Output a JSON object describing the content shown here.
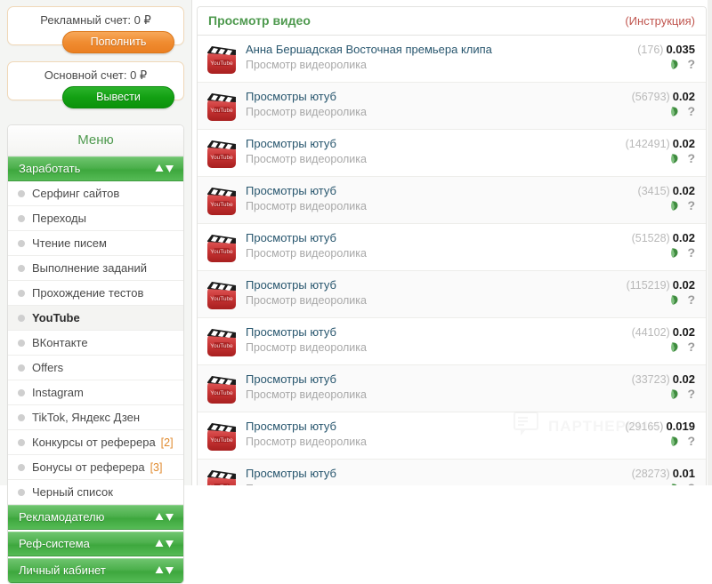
{
  "sidebar": {
    "accounts": [
      {
        "label": "Рекламный счет: 0 ₽",
        "button": "Пополнить",
        "style": "orange",
        "name": "ad-account"
      },
      {
        "label": "Основной счет: 0 ₽",
        "button": "Вывести",
        "style": "green",
        "name": "main-account"
      }
    ],
    "menu_title": "Меню",
    "groups": [
      {
        "label": "Заработать",
        "expanded": true,
        "items": [
          {
            "label": "Серфинг сайтов",
            "active": false,
            "badge": ""
          },
          {
            "label": "Переходы",
            "active": false,
            "badge": ""
          },
          {
            "label": "Чтение писем",
            "active": false,
            "badge": ""
          },
          {
            "label": "Выполнение заданий",
            "active": false,
            "badge": ""
          },
          {
            "label": "Прохождение тестов",
            "active": false,
            "badge": ""
          },
          {
            "label": "YouTube",
            "active": true,
            "badge": ""
          },
          {
            "label": "ВКонтакте",
            "active": false,
            "badge": ""
          },
          {
            "label": "Offers",
            "active": false,
            "badge": ""
          },
          {
            "label": "Instagram",
            "active": false,
            "badge": ""
          },
          {
            "label": "TikTok, Яндекс Дзен",
            "active": false,
            "badge": ""
          },
          {
            "label": "Конкурсы от реферера",
            "active": false,
            "badge": "[2]"
          },
          {
            "label": "Бонусы от реферера",
            "active": false,
            "badge": "[3]"
          },
          {
            "label": "Черный список",
            "active": false,
            "badge": ""
          }
        ]
      },
      {
        "label": "Рекламодателю",
        "expanded": false,
        "items": []
      },
      {
        "label": "Реф-система",
        "expanded": false,
        "items": []
      },
      {
        "label": "Личный кабинет",
        "expanded": false,
        "items": []
      }
    ]
  },
  "main": {
    "title": "Просмотр видео",
    "instruction_link": "(Инструкция)",
    "rows": [
      {
        "title": "Анна Бершадская Восточная премьера клипа",
        "subtitle": "Просмотр видеоролика",
        "count": "(176)",
        "price": "0.035"
      },
      {
        "title": "Просмотры ютуб",
        "subtitle": "Просмотр видеоролика",
        "count": "(56793)",
        "price": "0.02"
      },
      {
        "title": "Просмотры ютуб",
        "subtitle": "Просмотр видеоролика",
        "count": "(142491)",
        "price": "0.02"
      },
      {
        "title": "Просмотры ютуб",
        "subtitle": "Просмотр видеоролика",
        "count": "(3415)",
        "price": "0.02"
      },
      {
        "title": "Просмотры ютуб",
        "subtitle": "Просмотр видеоролика",
        "count": "(51528)",
        "price": "0.02"
      },
      {
        "title": "Просмотры ютуб",
        "subtitle": "Просмотр видеоролика",
        "count": "(115219)",
        "price": "0.02"
      },
      {
        "title": "Просмотры ютуб",
        "subtitle": "Просмотр видеоролика",
        "count": "(44102)",
        "price": "0.02"
      },
      {
        "title": "Просмотры ютуб",
        "subtitle": "Просмотр видеоролика",
        "count": "(33723)",
        "price": "0.02"
      },
      {
        "title": "Просмотры ютуб",
        "subtitle": "Просмотр видеоролика",
        "count": "(29165)",
        "price": "0.019"
      },
      {
        "title": "Просмотры ютуб",
        "subtitle": "Просмотр видеоролика",
        "count": "(28273)",
        "price": "0.01"
      }
    ],
    "row_icons": {
      "money": "money-icon",
      "help": "?"
    },
    "watermark_text": "ПАРТНЕРКИН"
  },
  "colors": {
    "green": "#4cb04c",
    "orange": "#ea7f22",
    "link_red": "#c0564f",
    "row_title": "#28566e",
    "thumb_red": "#c62828"
  }
}
